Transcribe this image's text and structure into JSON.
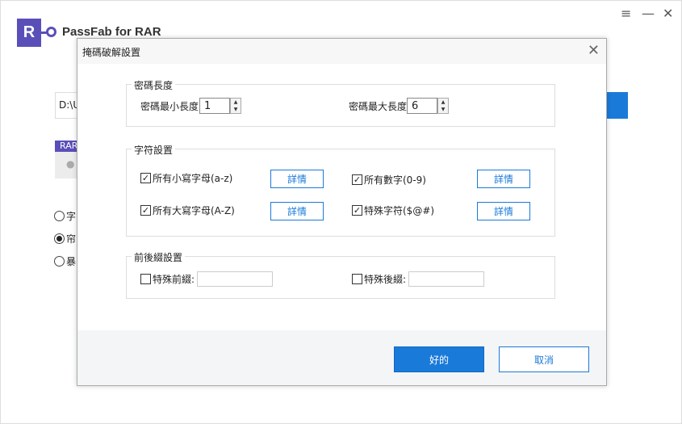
{
  "app": {
    "logo_letter": "R",
    "title": "PassFab for RAR",
    "menu_icon": "≡",
    "minimize_icon": "—",
    "close_icon": "✕"
  },
  "background": {
    "path_value": "D:\\U",
    "rar_label": "RAR",
    "radio_options": [
      {
        "label": "字",
        "selected": false
      },
      {
        "label": "帘",
        "selected": true
      },
      {
        "label": "暴",
        "selected": false
      }
    ]
  },
  "dialog": {
    "title": "掩碼破解設置",
    "length_group": {
      "label": "密碼長度",
      "min_label": "密碼最小長度",
      "min_value": "1",
      "max_label": "密碼最大長度",
      "max_value": "6"
    },
    "charset_group": {
      "label": "字符設置",
      "detail_label": "詳情",
      "options": [
        {
          "label": "所有小寫字母(a-z)",
          "checked": true
        },
        {
          "label": "所有數字(0-9)",
          "checked": true
        },
        {
          "label": "所有大寫字母(A-Z)",
          "checked": true
        },
        {
          "label": "特殊字符($@#)",
          "checked": true
        }
      ]
    },
    "affix_group": {
      "label": "前後綴設置",
      "prefix_label": "特殊前綴:",
      "prefix_value": "",
      "suffix_label": "特殊後綴:",
      "suffix_value": ""
    },
    "ok_label": "好的",
    "cancel_label": "取消"
  },
  "colors": {
    "brand": "#5a4fb8",
    "accent": "#1a7ad9"
  }
}
